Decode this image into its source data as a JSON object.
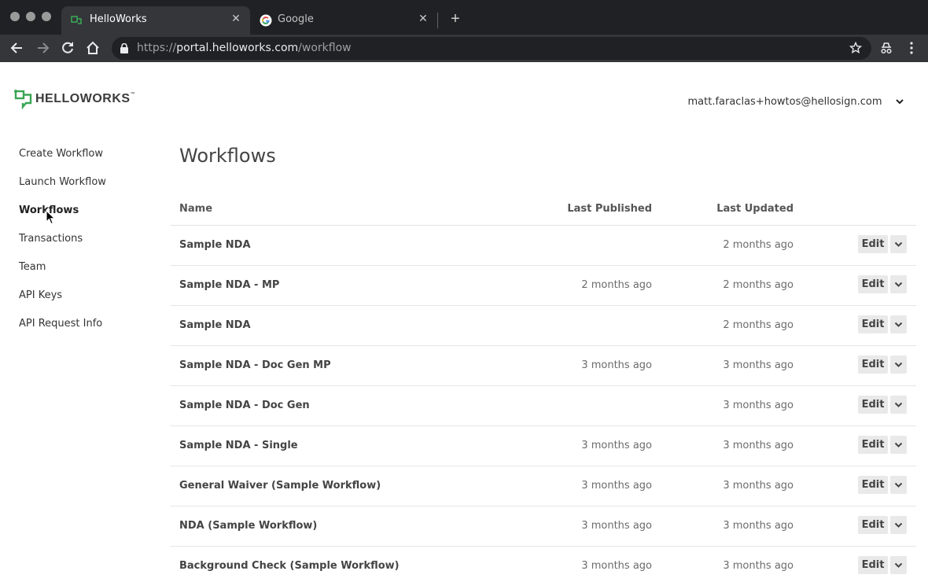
{
  "browser": {
    "tabs": [
      {
        "title": "HelloWorks",
        "active": true
      },
      {
        "title": "Google",
        "active": false
      }
    ],
    "url": {
      "scheme": "https://",
      "host": "portal.helloworks.com",
      "path": "/workflow"
    }
  },
  "header": {
    "logo_text": "HELLOWORKS",
    "account_email": "matt.faraclas+howtos@hellosign.com"
  },
  "sidebar": {
    "items": [
      {
        "label": "Create Workflow"
      },
      {
        "label": "Launch Workflow"
      },
      {
        "label": "Workflows",
        "active": true
      },
      {
        "label": "Transactions"
      },
      {
        "label": "Team"
      },
      {
        "label": "API Keys"
      },
      {
        "label": "API Request Info"
      }
    ]
  },
  "main": {
    "title": "Workflows",
    "columns": {
      "name": "Name",
      "last_published": "Last Published",
      "last_updated": "Last Updated"
    },
    "edit_label": "Edit",
    "rows": [
      {
        "name": "Sample NDA",
        "last_published": "",
        "last_updated": "2 months ago"
      },
      {
        "name": "Sample NDA - MP",
        "last_published": "2 months ago",
        "last_updated": "2 months ago"
      },
      {
        "name": "Sample NDA",
        "last_published": "",
        "last_updated": "2 months ago"
      },
      {
        "name": "Sample NDA - Doc Gen MP",
        "last_published": "3 months ago",
        "last_updated": "3 months ago"
      },
      {
        "name": "Sample NDA - Doc Gen",
        "last_published": "",
        "last_updated": "3 months ago"
      },
      {
        "name": "Sample NDA - Single",
        "last_published": "3 months ago",
        "last_updated": "3 months ago"
      },
      {
        "name": "General Waiver (Sample Workflow)",
        "last_published": "3 months ago",
        "last_updated": "3 months ago"
      },
      {
        "name": "NDA (Sample Workflow)",
        "last_published": "3 months ago",
        "last_updated": "3 months ago"
      },
      {
        "name": "Background Check (Sample Workflow)",
        "last_published": "3 months ago",
        "last_updated": "3 months ago"
      }
    ]
  },
  "colors": {
    "brand_green": "#3aa655",
    "chrome_dark": "#202124",
    "chrome_toolbar": "#35363a"
  }
}
